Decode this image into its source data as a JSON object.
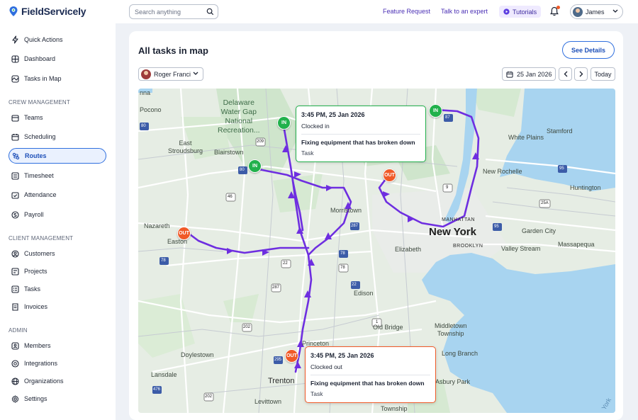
{
  "app": {
    "name": "FieldServicely"
  },
  "header": {
    "search_placeholder": "Search anything",
    "links": {
      "feature_request": "Feature Request",
      "talk_to_expert": "Talk to an expert",
      "tutorials": "Tutorials"
    },
    "user_name": "James"
  },
  "sidebar": {
    "top_items": [
      {
        "label": "Quick Actions",
        "icon": "bolt-icon"
      },
      {
        "label": "Dashboard",
        "icon": "grid-icon"
      },
      {
        "label": "Tasks in Map",
        "icon": "map-icon"
      }
    ],
    "sections": [
      {
        "title": "CREW MANAGEMENT",
        "items": [
          "Teams",
          "Scheduling",
          "Routes",
          "Timesheet",
          "Attendance",
          "Payroll"
        ]
      },
      {
        "title": "CLIENT MANAGEMENT",
        "items": [
          "Customers",
          "Projects",
          "Tasks",
          "Invoices"
        ]
      },
      {
        "title": "ADMIN",
        "items": [
          "Members",
          "Integrations",
          "Organizations",
          "Settings"
        ]
      }
    ],
    "active_item": "Routes"
  },
  "main": {
    "title": "All tasks in map",
    "see_details": "See Details",
    "employee": "Roger Franci",
    "date": "25 Jan 2026",
    "today": "Today"
  },
  "map": {
    "labels": {
      "nna": "nna",
      "pocono": "Pocono",
      "delaware": "Delaware\nWater Gap\nNational\nRecreation...",
      "east_stroudsburg": "East\nStroudsburg",
      "blairstown": "Blairstown",
      "white_plains": "White Plains",
      "stamford": "Stamford",
      "new_rochelle": "New Rochelle",
      "huntington": "Huntington",
      "morristown": "Morristown",
      "nazareth": "Nazareth",
      "easton": "Easton",
      "manhattan": "MANHATTAN",
      "new_york": "New York",
      "brooklyn": "BROOKLYN",
      "garden_city": "Garden City",
      "valley_stream": "Valley Stream",
      "massapequa": "Massapequa",
      "elizabeth": "Elizabeth",
      "edison": "Edison",
      "old_bridge": "Old Bridge",
      "middletown": "Middletown\nTownship",
      "princeton": "Princeton",
      "doylestown": "Doylestown",
      "long_branch": "Long Branch",
      "asbury_park": "Asbury Park",
      "lansdale": "Lansdale",
      "trenton": "Trenton",
      "levittown": "Levittown",
      "township": "Township",
      "york": "York"
    },
    "highway_shields": [
      "80",
      "209",
      "80",
      "46",
      "78",
      "287",
      "22",
      "78",
      "78",
      "22",
      "287",
      "202",
      "202",
      "295",
      "95",
      "476",
      "1",
      "9",
      "25A",
      "87",
      "95",
      "95"
    ],
    "markers": [
      {
        "type": "in",
        "label": "IN"
      },
      {
        "type": "in",
        "label": "IN"
      },
      {
        "type": "in",
        "label": "IN"
      },
      {
        "type": "out",
        "label": "OUT"
      },
      {
        "type": "out",
        "label": "OUT"
      },
      {
        "type": "out",
        "label": "OUT"
      }
    ],
    "popups": [
      {
        "time": "3:45 PM,  25 Jan 2026",
        "status": "Clocked in",
        "task": "Fixing equipment that has broken down",
        "sub": "Task"
      },
      {
        "time": "3:45 PM,  25 Jan 2026",
        "status": "Clocked out",
        "task": "Fixing equipment that has broken down",
        "sub": "Task"
      }
    ]
  },
  "colors": {
    "route": "#6e2ee0",
    "accent": "#2f6fde",
    "in": "#22b14c",
    "out": "#f05a28",
    "water": "#a8d4f0"
  }
}
